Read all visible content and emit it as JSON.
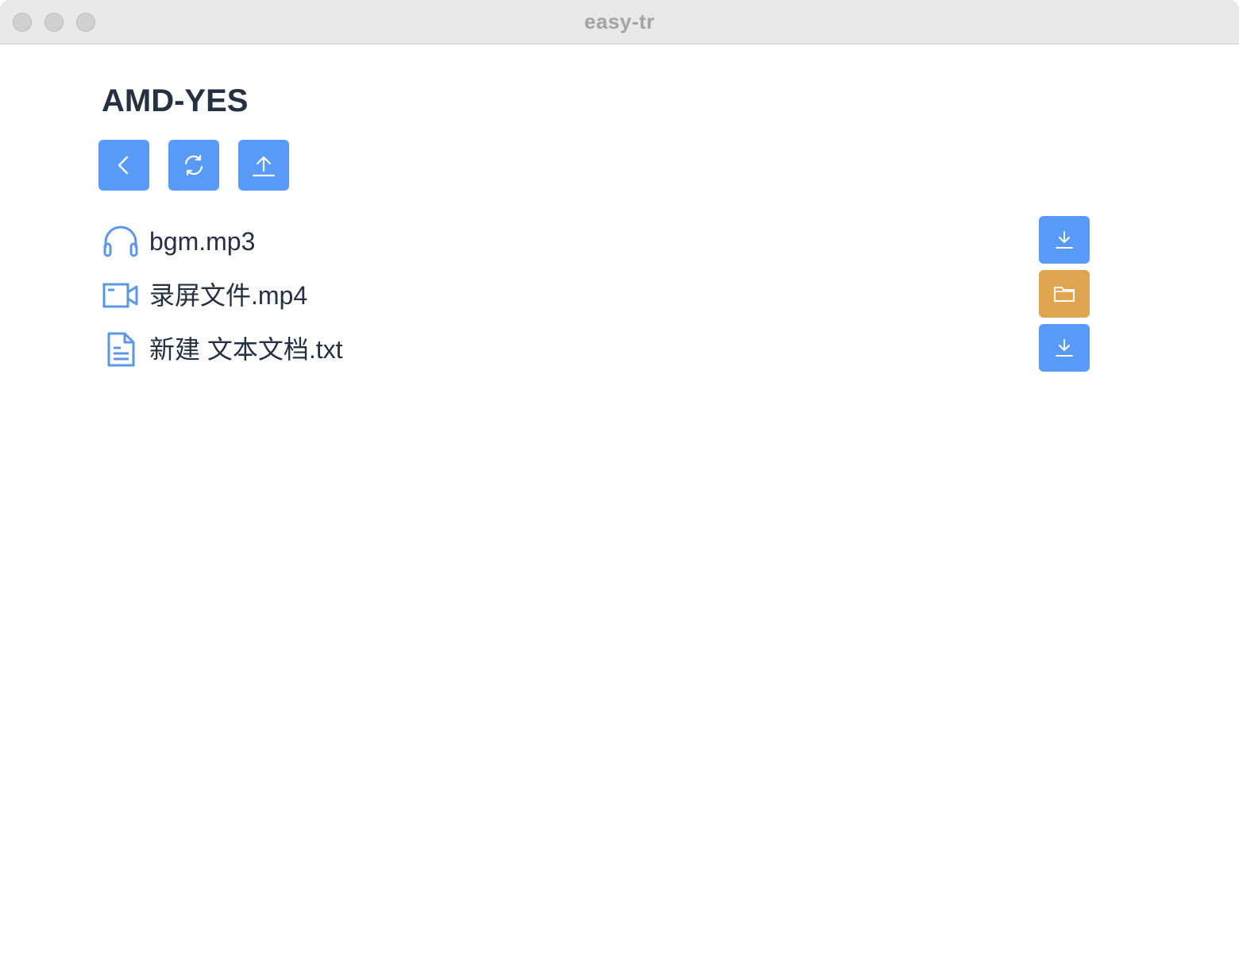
{
  "window": {
    "title": "easy-tr"
  },
  "page": {
    "title": "AMD-YES"
  },
  "toolbar": {
    "buttons": [
      {
        "name": "back",
        "icon": "chevron-left-icon"
      },
      {
        "name": "refresh",
        "icon": "refresh-icon"
      },
      {
        "name": "upload",
        "icon": "upload-icon"
      }
    ]
  },
  "files": [
    {
      "name": "bgm.mp3",
      "type_icon": "headphones-icon",
      "action": "download",
      "action_icon": "download-icon"
    },
    {
      "name": "录屏文件.mp4",
      "type_icon": "video-camera-icon",
      "action": "open-folder",
      "action_icon": "folder-icon"
    },
    {
      "name": "新建 文本文档.txt",
      "type_icon": "document-icon",
      "action": "download",
      "action_icon": "download-icon"
    }
  ],
  "colors": {
    "primary": "#579af8",
    "warning": "#dfa54f",
    "text": "#253142",
    "icon_blue": "#5b96e9",
    "titlebar": "#e7e8e7"
  }
}
